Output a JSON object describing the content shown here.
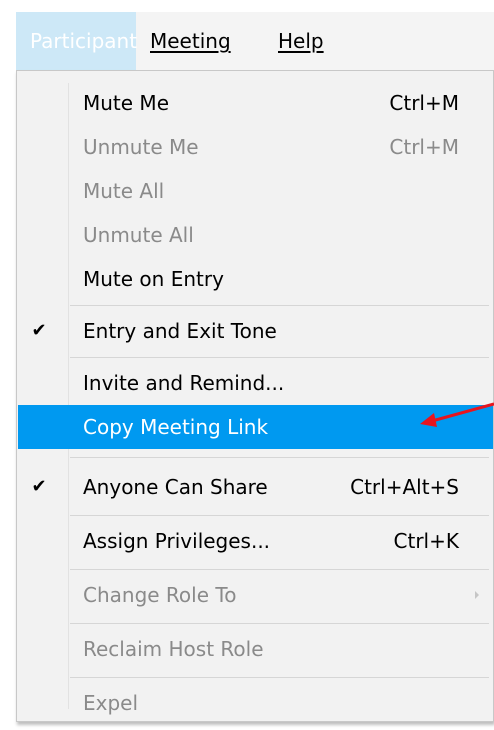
{
  "menubar": {
    "participant": "Participant",
    "meeting": "Meeting",
    "help": "Help"
  },
  "menu": {
    "mute_me": {
      "label": "Mute Me",
      "shortcut": "Ctrl+M"
    },
    "unmute_me": {
      "label": "Unmute Me",
      "shortcut": "Ctrl+M"
    },
    "mute_all": {
      "label": "Mute All"
    },
    "unmute_all": {
      "label": "Unmute All"
    },
    "mute_on_entry": {
      "label": "Mute on Entry"
    },
    "entry_exit_tone": {
      "label": "Entry and Exit Tone",
      "checked": true
    },
    "invite_remind": {
      "label": "Invite and Remind..."
    },
    "copy_link": {
      "label": "Copy Meeting Link"
    },
    "anyone_share": {
      "label": "Anyone Can Share",
      "shortcut": "Ctrl+Alt+S",
      "checked": true
    },
    "assign_privileges": {
      "label": "Assign Privileges...",
      "shortcut": "Ctrl+K"
    },
    "change_role": {
      "label": "Change Role To"
    },
    "reclaim_host": {
      "label": "Reclaim Host Role"
    },
    "expel": {
      "label": "Expel"
    }
  },
  "colors": {
    "highlight": "#0099f0",
    "annotation_arrow": "#e8141e",
    "disabled_text": "#8a8a8a"
  }
}
